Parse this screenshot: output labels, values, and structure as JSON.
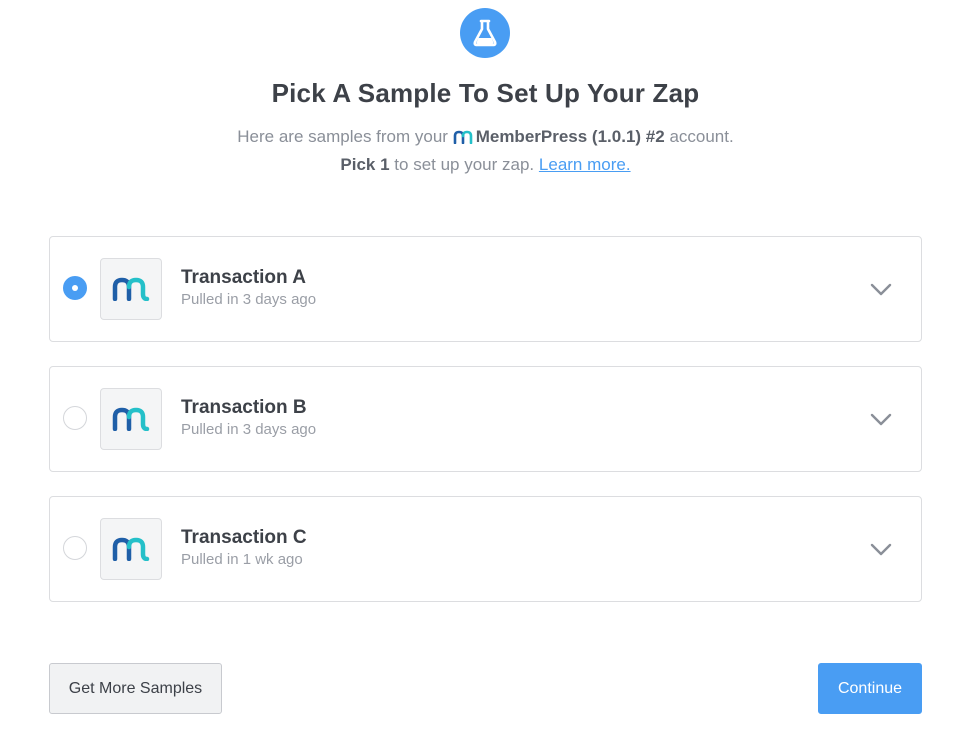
{
  "header": {
    "icon": "flask-icon",
    "title": "Pick A Sample To Set Up Your Zap",
    "subtitle_prefix": "Here are samples from your",
    "account_name": "MemberPress (1.0.1) #2",
    "subtitle_suffix": "account.",
    "pick_count": "Pick 1",
    "pick_suffix": "to set up your zap.",
    "learn_more": "Learn more."
  },
  "samples": [
    {
      "title": "Transaction A",
      "pulled": "Pulled in 3 days ago",
      "selected": true
    },
    {
      "title": "Transaction B",
      "pulled": "Pulled in 3 days ago",
      "selected": false
    },
    {
      "title": "Transaction C",
      "pulled": "Pulled in 1 wk ago",
      "selected": false
    }
  ],
  "footer": {
    "get_more_label": "Get More Samples",
    "continue_label": "Continue"
  },
  "colors": {
    "accent": "#499df3",
    "logo_teal": "#24c0c9",
    "logo_blue": "#1f5fa8"
  }
}
